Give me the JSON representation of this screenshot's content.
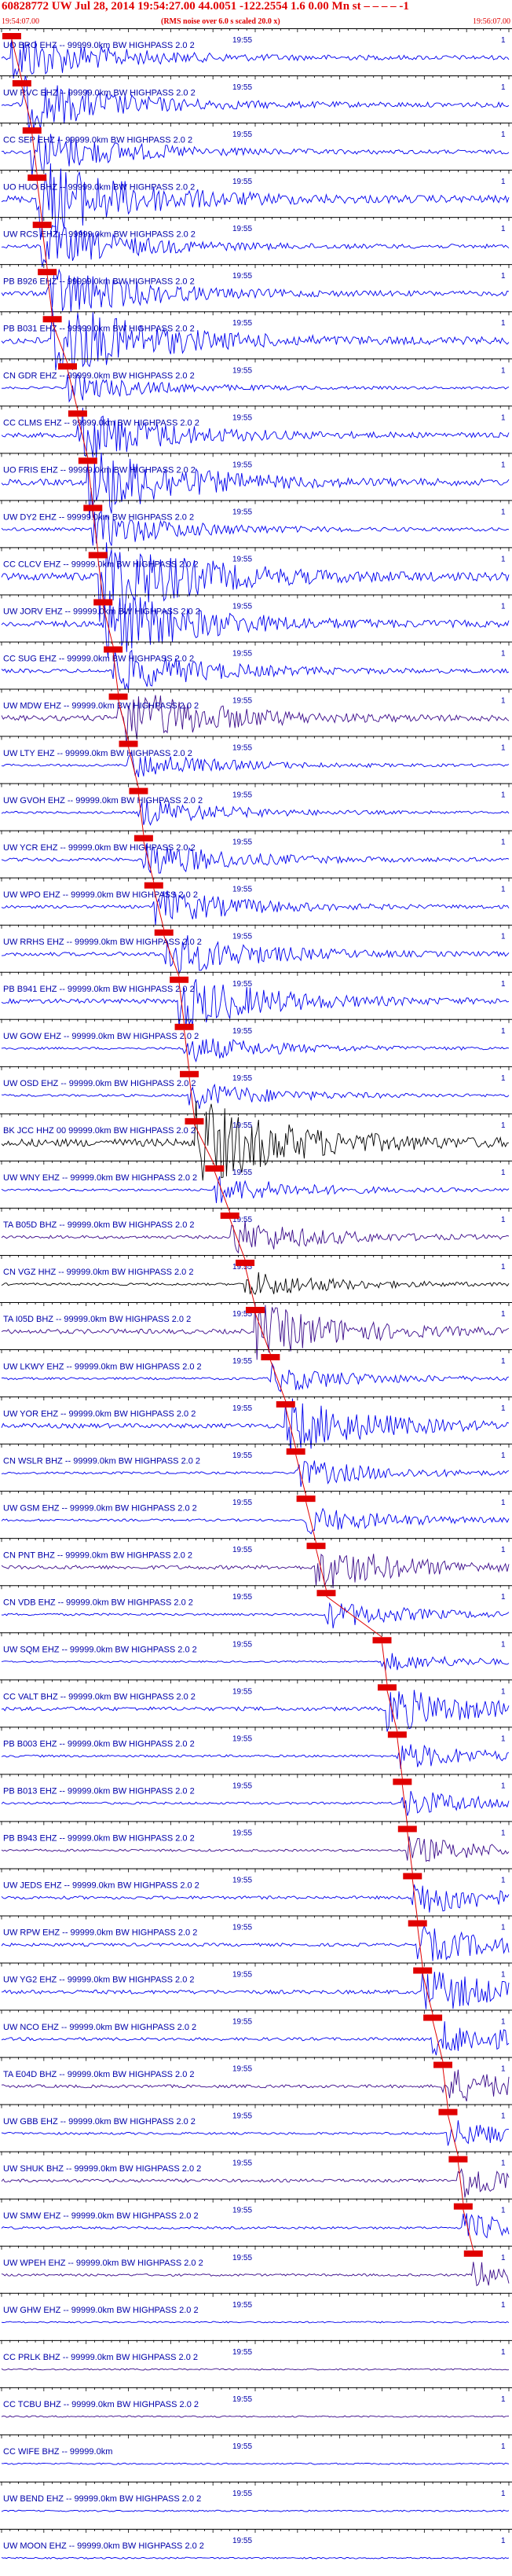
{
  "header": {
    "title": "60828772 UW Jul 28, 2014 19:54:27.00   44.0051 -122.2554  1.6 0.00 Mn st – – – – -1",
    "start_time": "19:54:07.00",
    "subtitle": "(RMS noise over 6.0 s scaled 20.0 x)",
    "end_time": "19:56:07.00"
  },
  "colors": {
    "blue": "#0000ee",
    "purple": "#3a0a8a",
    "black": "#000000",
    "pick": "#e00000",
    "tick_label": "#0000aa"
  },
  "chart_data": {
    "type": "line",
    "x_start": "19:54:07.00",
    "x_end": "19:56:07.00",
    "mid_tick_label": "19:55",
    "end_tick_label": "1",
    "traces": [
      {
        "label": "UO BRO EHZ -- 99999.0km BW  HIGHPASS  2.0  2",
        "color": "blue",
        "pick": 0.02,
        "amp": 0.55
      },
      {
        "label": "UW RVC EHZ -- 99999.0km BW  HIGHPASS  2.0  2",
        "color": "blue",
        "pick": 0.04,
        "amp": 0.6
      },
      {
        "label": "CC SEP EHZ -- 99999.0km BW  HIGHPASS  2.0  2",
        "color": "blue",
        "pick": 0.06,
        "amp": 0.5
      },
      {
        "label": "UO HUO BHZ -- 99999.0km BW  HIGHPASS  2.0  2",
        "color": "blue",
        "pick": 0.07,
        "amp": 0.9
      },
      {
        "label": "UW RCS EHZ -- 99999.0km BW  HIGHPASS  2.0  2",
        "color": "blue",
        "pick": 0.08,
        "amp": 0.5
      },
      {
        "label": "PB B926 EHZ -- 99999.0km BW  HIGHPASS  2.0  2",
        "color": "blue",
        "pick": 0.09,
        "amp": 0.6
      },
      {
        "label": "PB B031 EHZ -- 99999.0km BW  HIGHPASS  2.0  2",
        "color": "blue",
        "pick": 0.1,
        "amp": 0.9
      },
      {
        "label": "CN GDR EHZ -- 99999.0km BW  HIGHPASS  2.0  2",
        "color": "blue",
        "pick": 0.13,
        "amp": 0.3
      },
      {
        "label": "CC CLMS EHZ -- 99999.0km BW  HIGHPASS  2.0  2",
        "color": "blue",
        "pick": 0.15,
        "amp": 0.6
      },
      {
        "label": "UO FRIS EHZ -- 99999.0km BW  HIGHPASS  2.0  2",
        "color": "blue",
        "pick": 0.17,
        "amp": 0.8
      },
      {
        "label": "UW DY2 EHZ -- 99999.0km BW  HIGHPASS  2.0  2",
        "color": "blue",
        "pick": 0.18,
        "amp": 0.4
      },
      {
        "label": "CC CLCV EHZ -- 99999.0km BW  HIGHPASS  2.0  2",
        "color": "blue",
        "pick": 0.19,
        "amp": 1.0
      },
      {
        "label": "UW JORV EHZ -- 99999.0km BW  HIGHPASS  2.0  2",
        "color": "blue",
        "pick": 0.2,
        "amp": 0.8
      },
      {
        "label": "CC SUG EHZ -- 99999.0km BW  HIGHPASS  2.0  2",
        "color": "blue",
        "pick": 0.22,
        "amp": 0.5
      },
      {
        "label": "UW MDW EHZ -- 99999.0km BW  HIGHPASS  2.0  2",
        "color": "purple",
        "pick": 0.23,
        "amp": 0.7
      },
      {
        "label": "UW LTY EHZ -- 99999.0km BW  HIGHPASS  2.0  2",
        "color": "blue",
        "pick": 0.25,
        "amp": 0.3
      },
      {
        "label": "UW GVOH EHZ -- 99999.0km BW  HIGHPASS  2.0  2",
        "color": "blue",
        "pick": 0.27,
        "amp": 0.3
      },
      {
        "label": "UW YCR EHZ -- 99999.0km BW  HIGHPASS  2.0  2",
        "color": "blue",
        "pick": 0.28,
        "amp": 0.4
      },
      {
        "label": "UW WPO EHZ -- 99999.0km BW  HIGHPASS  2.0  2",
        "color": "blue",
        "pick": 0.3,
        "amp": 0.4
      },
      {
        "label": "UW RRHS EHZ -- 99999.0km BW  HIGHPASS  2.0  2",
        "color": "blue",
        "pick": 0.32,
        "amp": 0.5
      },
      {
        "label": "PB B941 EHZ -- 99999.0km BW  HIGHPASS  2.0  2",
        "color": "blue",
        "pick": 0.35,
        "amp": 0.6
      },
      {
        "label": "UW GOW EHZ -- 99999.0km BW  HIGHPASS  2.0  2",
        "color": "blue",
        "pick": 0.36,
        "amp": 0.3
      },
      {
        "label": "UW OSD EHZ -- 99999.0km BW  HIGHPASS  2.0  2",
        "color": "blue",
        "pick": 0.37,
        "amp": 0.3
      },
      {
        "label": "BK JCC HHZ 00 99999.0km BW  HIGHPASS  2.0  2",
        "color": "black",
        "pick": 0.38,
        "amp": 1.0
      },
      {
        "label": "UW WNY EHZ -- 99999.0km BW  HIGHPASS  2.0  2",
        "color": "blue",
        "pick": 0.42,
        "amp": 0.3
      },
      {
        "label": "TA B05D BHZ -- 99999.0km BW  HIGHPASS  2.0  2",
        "color": "purple",
        "pick": 0.45,
        "amp": 0.4
      },
      {
        "label": "CN VGZ HHZ -- 99999.0km BW  HIGHPASS  2.0  2",
        "color": "black",
        "pick": 0.48,
        "amp": 0.3
      },
      {
        "label": "TA I05D BHZ -- 99999.0km BW  HIGHPASS  2.0  2",
        "color": "purple",
        "pick": 0.5,
        "amp": 0.6
      },
      {
        "label": "UW LKWY EHZ -- 99999.0km BW  HIGHPASS  2.0  2",
        "color": "blue",
        "pick": 0.53,
        "amp": 0.3
      },
      {
        "label": "UW YOR EHZ -- 99999.0km BW  HIGHPASS  2.0  2",
        "color": "blue",
        "pick": 0.56,
        "amp": 0.6
      },
      {
        "label": "CN WSLR BHZ -- 99999.0km BW  HIGHPASS  2.0  2",
        "color": "blue",
        "pick": 0.58,
        "amp": 0.3
      },
      {
        "label": "UW GSM EHZ -- 99999.0km BW  HIGHPASS  2.0  2",
        "color": "blue",
        "pick": 0.6,
        "amp": 0.3
      },
      {
        "label": "CN PNT BHZ -- 99999.0km BW  HIGHPASS  2.0  2",
        "color": "purple",
        "pick": 0.62,
        "amp": 0.5
      },
      {
        "label": "CN VDB EHZ -- 99999.0km BW  HIGHPASS  2.0  2",
        "color": "blue",
        "pick": 0.64,
        "amp": 0.3
      },
      {
        "label": "UW SQM EHZ -- 99999.0km BW  HIGHPASS  2.0  2",
        "color": "blue",
        "pick": 0.75,
        "amp": 0.2
      },
      {
        "label": "CC VALT BHZ -- 99999.0km BW  HIGHPASS  2.0  2",
        "color": "blue",
        "pick": 0.76,
        "amp": 0.5
      },
      {
        "label": "PB B003 EHZ -- 99999.0km BW  HIGHPASS  2.0  2",
        "color": "blue",
        "pick": 0.78,
        "amp": 0.3
      },
      {
        "label": "PB B013 EHZ -- 99999.0km BW  HIGHPASS  2.0  2",
        "color": "blue",
        "pick": 0.79,
        "amp": 0.3
      },
      {
        "label": "PB B943 EHZ -- 99999.0km BW  HIGHPASS  2.0  2",
        "color": "purple",
        "pick": 0.8,
        "amp": 0.3
      },
      {
        "label": "UW JEDS EHZ -- 99999.0km BW  HIGHPASS  2.0  2",
        "color": "blue",
        "pick": 0.81,
        "amp": 0.4
      },
      {
        "label": "UW RPW EHZ -- 99999.0km BW  HIGHPASS  2.0  2",
        "color": "blue",
        "pick": 0.82,
        "amp": 0.4
      },
      {
        "label": "UW YG2 EHZ -- 99999.0km BW  HIGHPASS  2.0  2",
        "color": "blue",
        "pick": 0.83,
        "amp": 0.5
      },
      {
        "label": "UW NCO EHZ -- 99999.0km BW  HIGHPASS  2.0  2",
        "color": "blue",
        "pick": 0.85,
        "amp": 0.4
      },
      {
        "label": "TA E04D BHZ -- 99999.0km BW  HIGHPASS  2.0  2",
        "color": "purple",
        "pick": 0.87,
        "amp": 0.4
      },
      {
        "label": "UW GBB EHZ -- 99999.0km BW  HIGHPASS  2.0  2",
        "color": "blue",
        "pick": 0.88,
        "amp": 0.3
      },
      {
        "label": "UW SHUK BHZ -- 99999.0km BW  HIGHPASS  2.0  2",
        "color": "purple",
        "pick": 0.9,
        "amp": 0.4
      },
      {
        "label": "UW SMW EHZ -- 99999.0km BW  HIGHPASS  2.0  2",
        "color": "blue",
        "pick": 0.91,
        "amp": 0.3
      },
      {
        "label": "UW WPEH EHZ -- 99999.0km BW  HIGHPASS  2.0  2",
        "color": "purple",
        "pick": 0.93,
        "amp": 0.3
      },
      {
        "label": "UW GHW EHZ -- 99999.0km BW  HIGHPASS  2.0  2",
        "color": "blue",
        "pick": null,
        "amp": 0.2
      },
      {
        "label": "CC PRLK BHZ -- 99999.0km BW  HIGHPASS  2.0  2",
        "color": "purple",
        "pick": null,
        "amp": 0.2
      },
      {
        "label": "CC TCBU BHZ -- 99999.0km BW  HIGHPASS  2.0  2",
        "color": "purple",
        "pick": null,
        "amp": 0.2
      },
      {
        "label": "CC WIFE BHZ -- 99999.0km",
        "color": "blue",
        "pick": null,
        "amp": 0.2
      },
      {
        "label": "UW BEND EHZ -- 99999.0km BW  HIGHPASS  2.0  2",
        "color": "blue",
        "pick": null,
        "amp": 0.2
      },
      {
        "label": "UW MOON EHZ -- 99999.0km BW  HIGHPASS  2.0  2",
        "color": "blue",
        "pick": null,
        "amp": 0.2
      }
    ]
  }
}
